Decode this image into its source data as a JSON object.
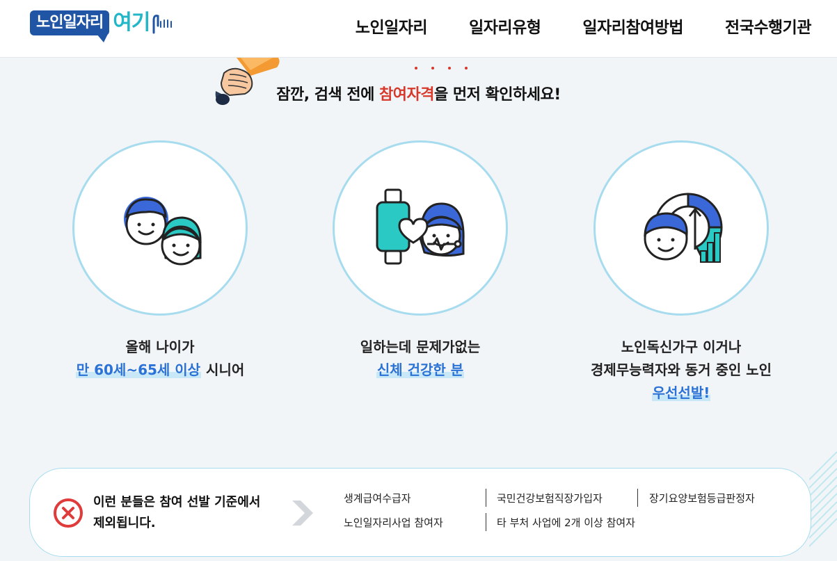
{
  "header": {
    "logo_text": "노인일자리",
    "logo_accent": "여기",
    "nav": [
      "노인일자리",
      "일자리유형",
      "일자리참여방법",
      "전국수행기관"
    ]
  },
  "notice": {
    "before": "잠깐, 검색 전에 ",
    "highlight": "참여자격",
    "after": "을 먼저 확인하세요!"
  },
  "cards": [
    {
      "line1": "올해 나이가",
      "line2_highlight": "만 60세~65세 이상",
      "line2_rest": " 시니어"
    },
    {
      "line1": "일하는데 문제가없는",
      "line2_highlight": "신체 건강한 분"
    },
    {
      "line1": "노인독신가구 이거나",
      "line2": "경제무능력자와 동거 중인 노인",
      "line3_highlight": "우선선발!"
    }
  ],
  "exclusion": {
    "title_line1": "이런 분들은 참여 선발 기준에서",
    "title_line2": "제외됩니다.",
    "items": [
      "생계급여수급자",
      "국민건강보험직장가입자",
      "장기요양보험등급판정자",
      "노인일자리사업 참여자",
      "타 부처 사업에 2개 이상 참여자"
    ]
  },
  "colors": {
    "brand_blue": "#1f55a4",
    "accent_teal": "#22b6c9",
    "highlight_red": "#d6392b",
    "highlight_blue": "#2a72d6"
  }
}
